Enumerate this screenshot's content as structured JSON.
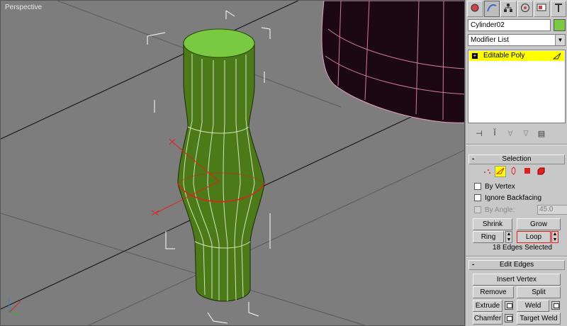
{
  "viewport": {
    "label": "Perspective",
    "background": "#7d7d7d",
    "object_color": "#7ac943",
    "selection_color": "#e02020"
  },
  "panel": {
    "tabs": [
      "create-icon",
      "modify-icon",
      "hierarchy-icon",
      "motion-icon",
      "display-icon",
      "utilities-icon"
    ],
    "object_name": "Cylinder02",
    "object_color": "#7ac943",
    "modifier_list": "Modifier List",
    "stack_items": [
      {
        "label": "Editable Poly",
        "highlight": "#ffff00"
      }
    ],
    "selection_rollout": {
      "title": "Selection",
      "by_vertex": "By Vertex",
      "ignore_backfacing": "Ignore Backfacing",
      "by_angle": "By Angle:",
      "by_angle_value": "45.0",
      "shrink": "Shrink",
      "grow": "Grow",
      "ring": "Ring",
      "loop": "Loop",
      "selection_count": "18 Edges Selected"
    },
    "edit_edges_rollout": {
      "title": "Edit Edges",
      "insert_vertex": "Insert Vertex",
      "remove": "Remove",
      "split": "Split",
      "extrude": "Extrude",
      "weld": "Weld",
      "chamfer": "Chamfer",
      "target_weld": "Target Weld"
    }
  }
}
